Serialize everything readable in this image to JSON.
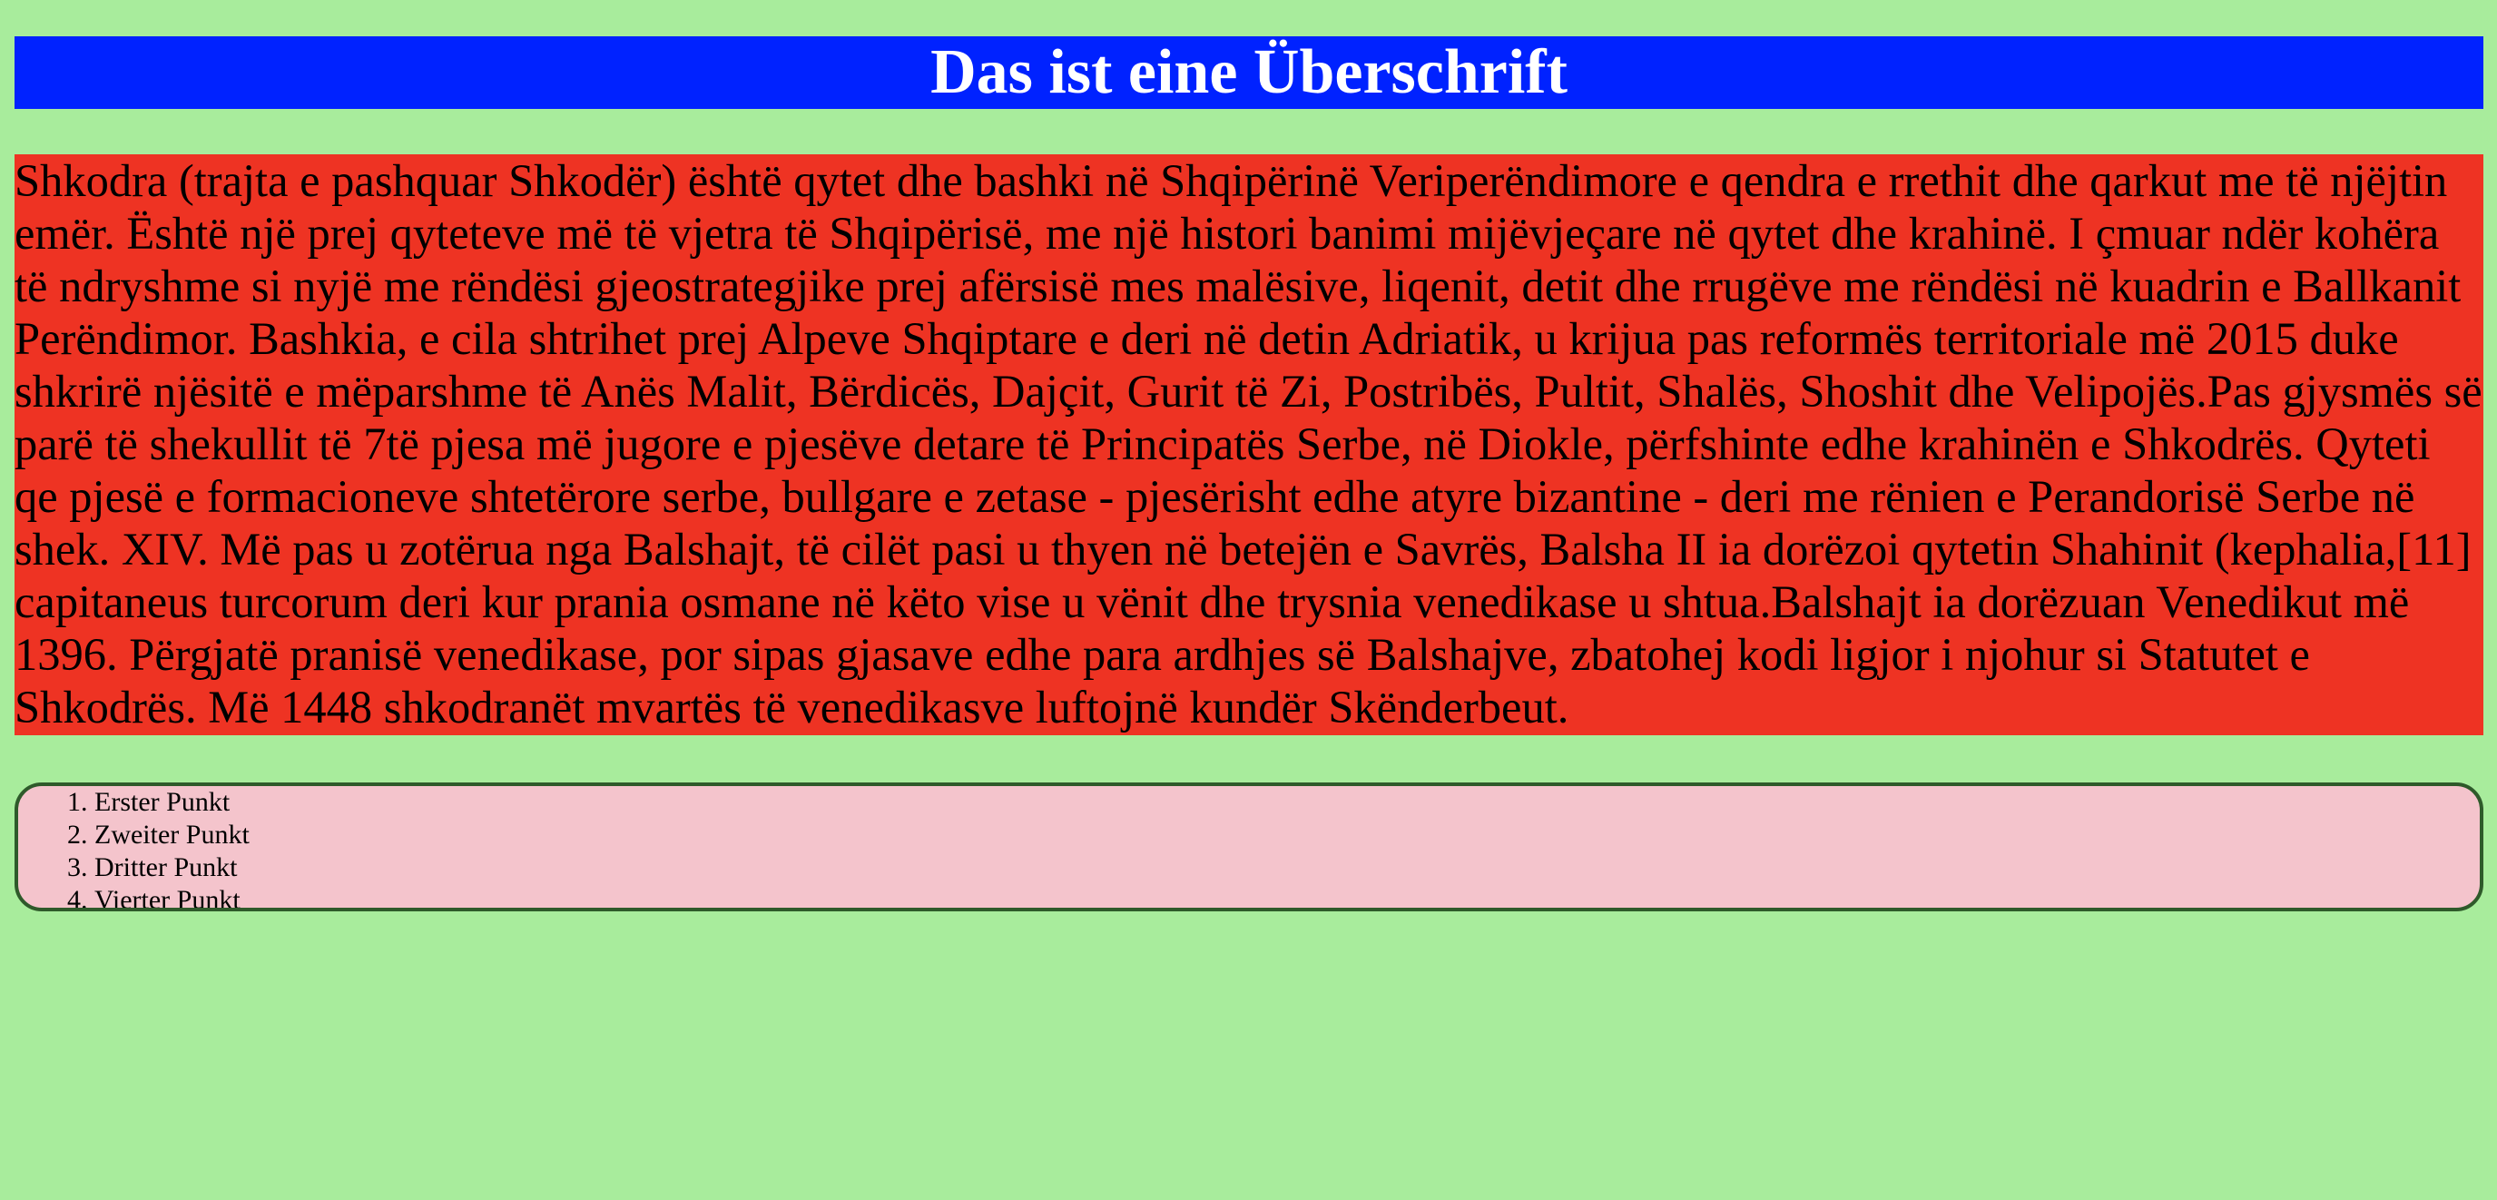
{
  "heading": "Das ist eine Überschrift",
  "paragraph": "Shkodra (trajta e pashquar Shkodër) është qytet dhe bashki në Shqipërinë Veriperëndimore e qendra e rrethit dhe qarkut me të njëjtin emër. Është një prej qyteteve më të vjetra të Shqipërisë, me një histori banimi mijëvjeçare në qytet dhe krahinë. I çmuar ndër kohëra të ndryshme si nyjë me rëndësi gjeostrategjike prej afërsisë mes malësive, liqenit, detit dhe rrugëve me rëndësi në kuadrin e Ballkanit Perëndimor. Bashkia, e cila shtrihet prej Alpeve Shqiptare e deri në detin Adriatik, u krijua pas reformës territoriale më 2015 duke shkrirë njësitë e mëparshme të Anës Malit, Bërdicës, Dajçit, Gurit të Zi, Postribës, Pultit, Shalës, Shoshit dhe Velipojës.Pas gjysmës së parë të shekullit të 7të pjesa më jugore e pjesëve detare të Principatës Serbe, në Diokle, përfshinte edhe krahinën e Shkodrës. Qyteti qe pjesë e formacioneve shtetërore serbe, bullgare e zetase - pjesërisht edhe atyre bizantine - deri me rënien e Perandorisë Serbe në shek. XIV. Më pas u zotërua nga Balshajt, të cilët pasi u thyen në betejën e Savrës, Balsha II ia dorëzoi qytetin Shahinit (kephalia,[11] capitaneus turcorum deri kur prania osmane në këto vise u vënit dhe trysnia venedikase u shtua.Balshajt ia dorëzuan Venedikut më 1396. Përgjatë pranisë venedikase, por sipas gjasave edhe para ardhjes së Balshajve, zbatohej kodi ligjor i njohur si Statutet e Shkodrës. Më 1448 shkodranët mvartës të venedikasve luftojnë kundër Skënderbeut.",
  "list": {
    "items": [
      "Erster Punkt",
      "Zweiter Punkt",
      "Dritter Punkt",
      "Vierter Punkt"
    ]
  },
  "colors": {
    "background": "#a8ec9c",
    "heading_bg": "#0022ff",
    "heading_text": "#ffffff",
    "paragraph_bg": "#ee3323",
    "list_bg": "#f4c4cc",
    "list_border": "#2e5a2a"
  }
}
